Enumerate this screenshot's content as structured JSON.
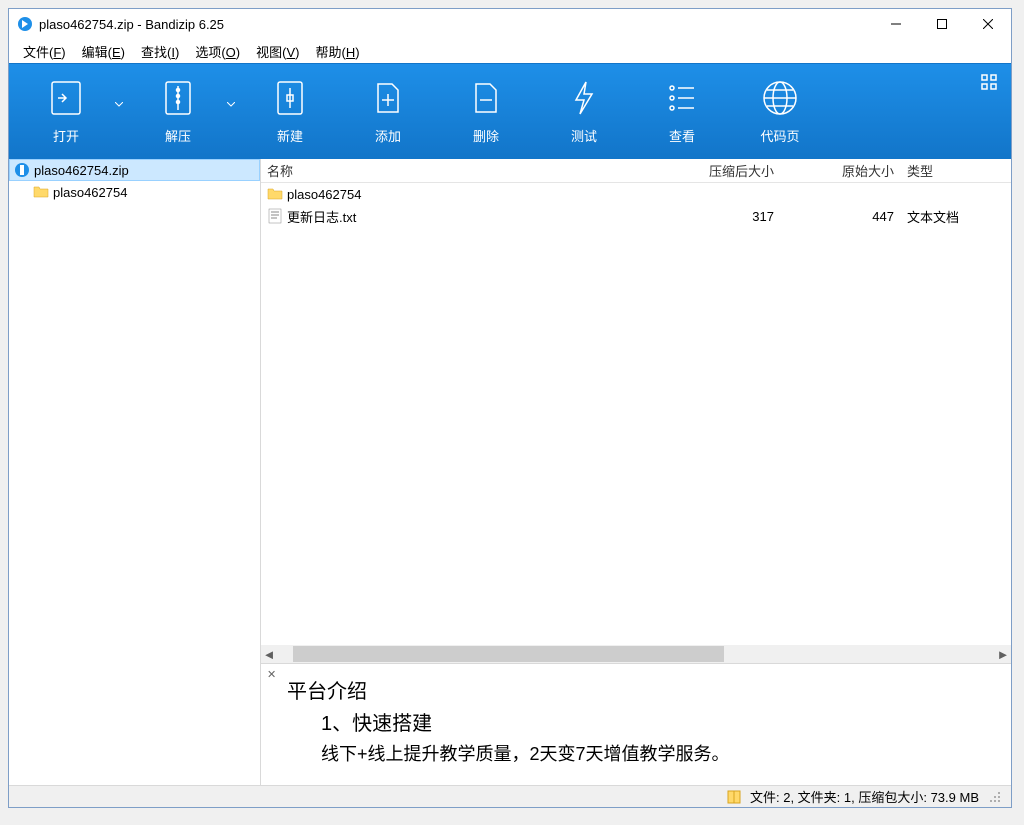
{
  "window": {
    "title": "plaso462754.zip - Bandizip 6.25"
  },
  "menus": {
    "file": "文件(",
    "file_u": "F",
    "edit": "编辑(",
    "edit_u": "E",
    "find": "查找(",
    "find_u": "I",
    "options": "选项(",
    "options_u": "O",
    "view": "视图(",
    "view_u": "V",
    "help": "帮助(",
    "help_u": "H",
    "close_paren": ")"
  },
  "toolbar": {
    "open": "打开",
    "extract": "解压",
    "new": "新建",
    "add": "添加",
    "delete": "删除",
    "test": "测试",
    "view": "查看",
    "codepage": "代码页"
  },
  "tree": {
    "root": "plaso462754.zip",
    "child": "plaso462754"
  },
  "columns": {
    "name": "名称",
    "compressed": "压缩后大小",
    "original": "原始大小",
    "type": "类型"
  },
  "files": [
    {
      "name": "plaso462754",
      "compressed": "",
      "original": "",
      "type": "",
      "icon": "folder"
    },
    {
      "name": "更新日志.txt",
      "compressed": "317",
      "original": "447",
      "type": "文本文档",
      "icon": "txt"
    }
  ],
  "preview": {
    "title": "平台介绍",
    "line1": "1、快速搭建",
    "line2": "线下+线上提升教学质量，2天变7天增值教学服务。"
  },
  "status": {
    "text": "文件: 2, 文件夹: 1, 压缩包大小: 73.9 MB"
  }
}
